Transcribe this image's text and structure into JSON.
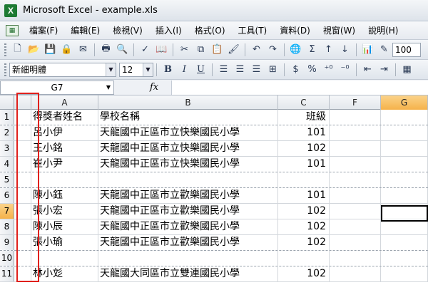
{
  "window": {
    "title": "Microsoft Excel - example.xls"
  },
  "menu": [
    "檔案(F)",
    "編輯(E)",
    "檢視(V)",
    "插入(I)",
    "格式(O)",
    "工具(T)",
    "資料(D)",
    "視窗(W)",
    "說明(H)"
  ],
  "toolbar": {
    "zoom": "100"
  },
  "format_toolbar": {
    "font": "新細明體",
    "size": "12",
    "bold": "B",
    "italic": "I",
    "underline": "U",
    "currency": "$",
    "percent": "%"
  },
  "formula_bar": {
    "name_box": "G7",
    "fx": "fx",
    "value": ""
  },
  "columns": [
    "A",
    "B",
    "C",
    "F",
    "G"
  ],
  "active_column": "G",
  "rows": [
    {
      "n": "1",
      "a": "得獎者姓名",
      "b": "學校名稱",
      "c": "班級"
    },
    {
      "n": "2",
      "a": "呂小伊",
      "b": "天龍國中正區市立快樂國民小學",
      "c": "101"
    },
    {
      "n": "3",
      "a": "王小銘",
      "b": "天龍國中正區市立快樂國民小學",
      "c": "102"
    },
    {
      "n": "4",
      "a": "崔小尹",
      "b": "天龍國中正區市立快樂國民小學",
      "c": "101"
    },
    {
      "n": "5",
      "a": "",
      "b": "",
      "c": ""
    },
    {
      "n": "6",
      "a": "陳小鈺",
      "b": "天龍國中正區市立歡樂國民小學",
      "c": "101"
    },
    {
      "n": "7",
      "a": "張小宏",
      "b": "天龍國中正區市立歡樂國民小學",
      "c": "102"
    },
    {
      "n": "8",
      "a": "陳小辰",
      "b": "天龍國中正區市立歡樂國民小學",
      "c": "102"
    },
    {
      "n": "9",
      "a": "張小瑜",
      "b": "天龍國中正區市立歡樂國民小學",
      "c": "102"
    },
    {
      "n": "10",
      "a": "",
      "b": "",
      "c": ""
    },
    {
      "n": "11",
      "a": "林小彣",
      "b": "天龍國大同區市立雙連國民小學",
      "c": "102"
    }
  ],
  "active_row": "7"
}
